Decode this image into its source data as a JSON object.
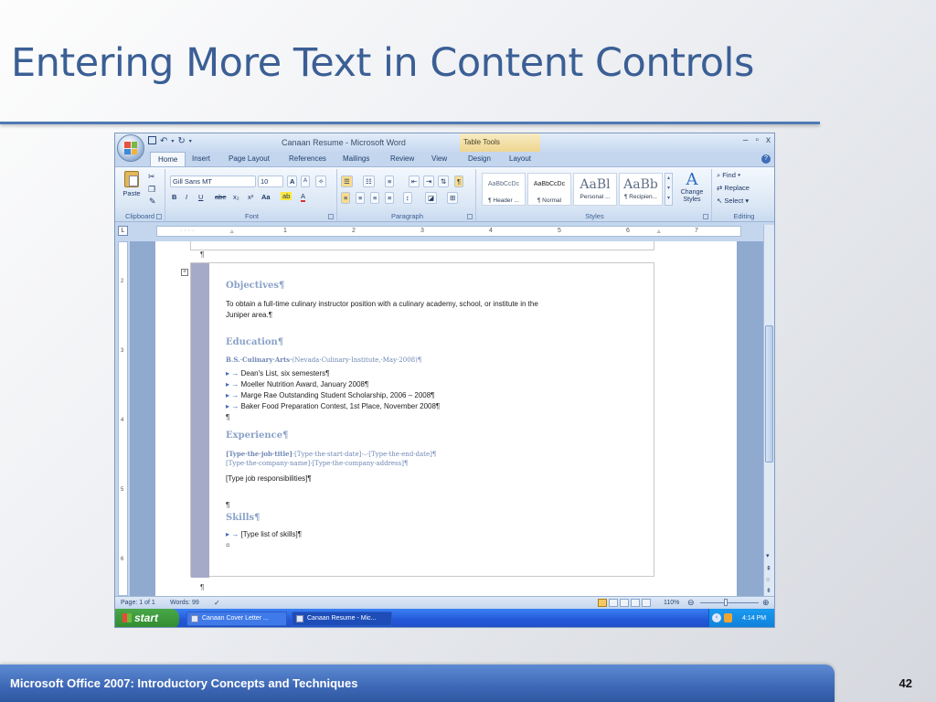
{
  "slide": {
    "title": "Entering More Text in Content Controls",
    "footer": "Microsoft Office 2007: Introductory Concepts and Techniques",
    "page_number": "42"
  },
  "window": {
    "title": "Canaan Resume - Microsoft Word",
    "contextual_tab_title": "Table Tools",
    "controls": [
      "–",
      "▫",
      "x"
    ]
  },
  "tabs": [
    {
      "label": "Home",
      "active": true
    },
    {
      "label": "Insert"
    },
    {
      "label": "Page Layout"
    },
    {
      "label": "References"
    },
    {
      "label": "Mailings"
    },
    {
      "label": "Review"
    },
    {
      "label": "View"
    },
    {
      "label": "Design"
    },
    {
      "label": "Layout"
    }
  ],
  "ribbon": {
    "clipboard": {
      "label": "Clipboard",
      "paste": "Paste"
    },
    "font": {
      "label": "Font",
      "name": "Gill Sans MT",
      "size": "10",
      "bold": "B",
      "italic": "I",
      "underline": "U",
      "strike": "abe",
      "subscript": "x₂",
      "superscript": "x²",
      "change_case": "Aa",
      "grow": "A",
      "shrink": "A"
    },
    "paragraph": {
      "label": "Paragraph"
    },
    "styles": {
      "label": "Styles",
      "items": [
        {
          "sample": "AaBbCcDc",
          "name": "¶ Header ..."
        },
        {
          "sample": "AaBbCcDc",
          "name": "¶ Normal"
        },
        {
          "sample": "AaBl",
          "name": "Personal ..."
        },
        {
          "sample": "AaBb",
          "name": "¶ Recipien..."
        }
      ],
      "change_styles": "Change Styles"
    },
    "editing": {
      "label": "Editing",
      "find": "Find",
      "replace": "Replace",
      "select": "Select"
    }
  },
  "ruler": {
    "numbers": [
      "1",
      "2",
      "3",
      "4",
      "5",
      "6",
      "7"
    ]
  },
  "vruler_numbers": [
    "2",
    "3",
    "4",
    "5",
    "6"
  ],
  "document": {
    "pilcrow_top": "¶",
    "objectives_heading": "Objectives¶",
    "objectives_line1": "To obtain a full-time culinary instructor position with a culinary academy, school, or institute in the",
    "objectives_line2": "Juniper area.¶",
    "education_heading": "Education¶",
    "degree_bold": "B.S.·Culinary·Arts·",
    "degree_rest": "(Nevada·Culinary·Institute,·May·2008)¶",
    "bullets": [
      "Dean's List, six semesters¶",
      "Moeller Nutrition Award, January 2008¶",
      "Marge Rae Outstanding Student Scholarship, 2006 – 2008¶",
      "Baker Food Preparation Contest, 1st Place, November 2008¶"
    ],
    "pilcrow_after_edu": "¶",
    "experience_heading": "Experience¶",
    "job_title": "[Type·the·job·title]",
    "job_dates": "·[Type·the·start·date]·–·[Type·the·end·date]¶",
    "company": "[Type·the·company·name]·[Type·the·company·address]¶",
    "responsibilities": "[Type job responsibilities]¶",
    "pilcrow_before_skills": "¶",
    "skills_heading": "Skills¶",
    "skills_bullet": "[Type list of skills]¶",
    "end_cell": "¤",
    "pilcrow_bottom": "¶"
  },
  "status": {
    "page": "Page: 1 of 1",
    "words": "Words: 99",
    "zoom": "110%"
  },
  "taskbar": {
    "start": "start",
    "items": [
      "Canaan Cover Letter ...",
      "Canaan Resume - Mic..."
    ],
    "clock": "4:14 PM"
  },
  "colors": {
    "title": "#3b5f95",
    "accent": "#4f79b4",
    "heading": "#8aa2c8"
  }
}
